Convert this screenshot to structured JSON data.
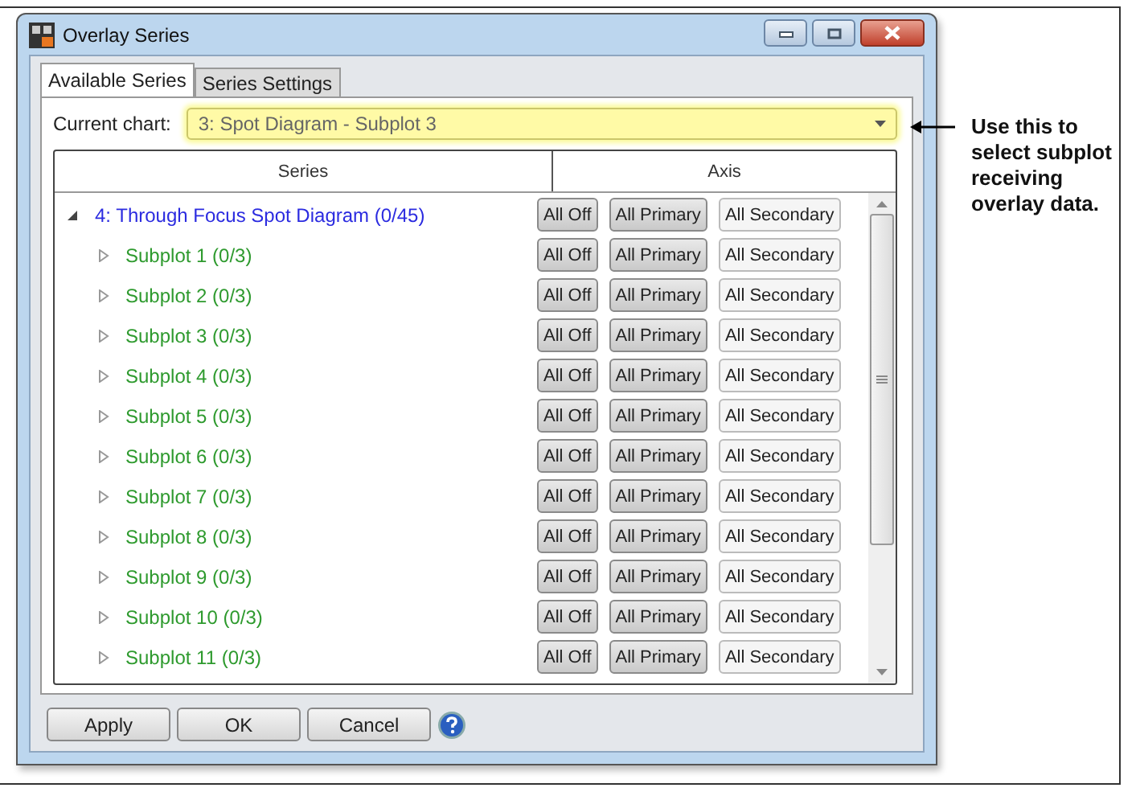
{
  "window": {
    "title": "Overlay Series"
  },
  "tabs": [
    {
      "label": "Available Series",
      "selected": true
    },
    {
      "label": "Series Settings",
      "selected": false
    }
  ],
  "current_chart": {
    "label": "Current chart:",
    "value": "3: Spot Diagram - Subplot 3"
  },
  "table": {
    "columns": [
      "Series",
      "Axis"
    ],
    "rows": [
      {
        "label": "4: Through Focus Spot Diagram (0/45)",
        "kind": "group",
        "expanded": true,
        "buttons": [
          "All Off",
          "All Primary",
          "All Secondary"
        ]
      },
      {
        "label": "Subplot 1 (0/3)",
        "kind": "subplot",
        "expanded": false,
        "buttons": [
          "All Off",
          "All Primary",
          "All Secondary"
        ]
      },
      {
        "label": "Subplot 2 (0/3)",
        "kind": "subplot",
        "expanded": false,
        "buttons": [
          "All Off",
          "All Primary",
          "All Secondary"
        ]
      },
      {
        "label": "Subplot 3 (0/3)",
        "kind": "subplot",
        "expanded": false,
        "buttons": [
          "All Off",
          "All Primary",
          "All Secondary"
        ]
      },
      {
        "label": "Subplot 4 (0/3)",
        "kind": "subplot",
        "expanded": false,
        "buttons": [
          "All Off",
          "All Primary",
          "All Secondary"
        ]
      },
      {
        "label": "Subplot 5 (0/3)",
        "kind": "subplot",
        "expanded": false,
        "buttons": [
          "All Off",
          "All Primary",
          "All Secondary"
        ]
      },
      {
        "label": "Subplot 6 (0/3)",
        "kind": "subplot",
        "expanded": false,
        "buttons": [
          "All Off",
          "All Primary",
          "All Secondary"
        ]
      },
      {
        "label": "Subplot 7 (0/3)",
        "kind": "subplot",
        "expanded": false,
        "buttons": [
          "All Off",
          "All Primary",
          "All Secondary"
        ]
      },
      {
        "label": "Subplot 8 (0/3)",
        "kind": "subplot",
        "expanded": false,
        "buttons": [
          "All Off",
          "All Primary",
          "All Secondary"
        ]
      },
      {
        "label": "Subplot 9 (0/3)",
        "kind": "subplot",
        "expanded": false,
        "buttons": [
          "All Off",
          "All Primary",
          "All Secondary"
        ]
      },
      {
        "label": "Subplot 10 (0/3)",
        "kind": "subplot",
        "expanded": false,
        "buttons": [
          "All Off",
          "All Primary",
          "All Secondary"
        ]
      },
      {
        "label": "Subplot 11 (0/3)",
        "kind": "subplot",
        "expanded": false,
        "buttons": [
          "All Off",
          "All Primary",
          "All Secondary"
        ]
      }
    ]
  },
  "buttons": [
    "Apply",
    "OK",
    "Cancel"
  ],
  "callout": {
    "text": "Use this to select subplot receiving overlay data."
  }
}
